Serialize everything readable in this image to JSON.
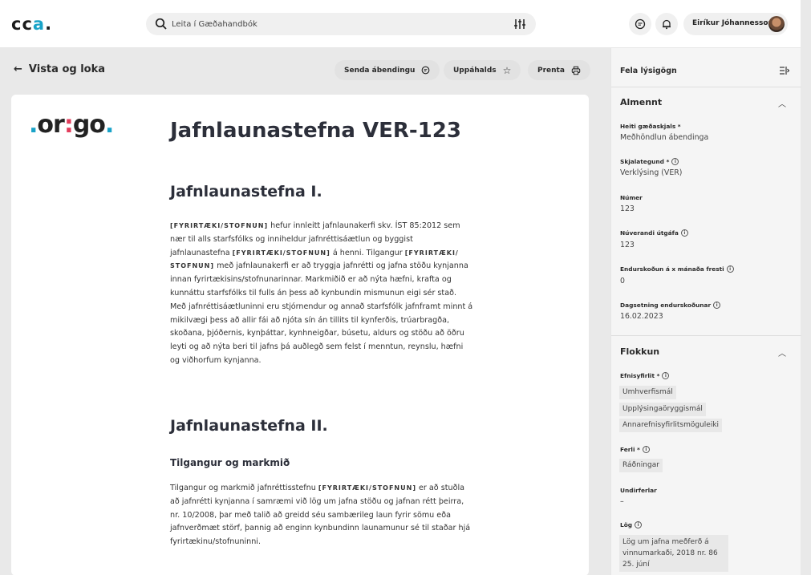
{
  "app": {
    "logo": "cca.",
    "search_placeholder": "Leita í Gæðahandbók",
    "user_name": "Eiríkur Jóhannesson"
  },
  "actions": {
    "back_label": "Vista og loka",
    "send_feedback": "Senda ábendingu",
    "favorites": "Uppáhalds",
    "print": "Prenta"
  },
  "document": {
    "company_logo": "origo.",
    "title": "Jafnlaunastefna VER-123",
    "section1_title": "Jafnlaunastefna I.",
    "section1_body": {
      "p1_tag": "[FYRIRTÆKI/STOFNUN]",
      "p1_text1": " hefur innleitt jafnlaunakerfi skv. ÍST 85:2012 sem nær til alls starfsfólks og inniheldur jafnréttisáætlun og byggist jafnlaunastefna ",
      "p1_tag2": "[FYRIRTÆKI/STOFNUN]",
      "p1_text2": " á henni. Tilgangur ",
      "p1_tag3": "[FYRIRTÆKI/ STOFNUN]",
      "p1_text3": " með jafnlaunakerfi er að tryggja jafnrétti og jafna stöðu kynjanna innan fyrirtækisins/stofnunarinnar. Markmiðið er að nýta hæfni, krafta og kunnáttu starfsfólks til fulls án þess að kynbundin mismunun eigi sér stað. Með jafnréttisáætluninni eru stjórnendur og annað starfsfólk jafnframt minnt á mikilvægi þess að allir fái að njóta sín án tillits til kynferðis, trúarbragða, skoðana, þjóðernis, kynþáttar, kynhneigðar, búsetu, aldurs og stöðu að öðru leyti og að nýta beri til jafns þá auðlegð sem felst í menntun, reynslu, hæfni og viðhorfum kynjanna."
    },
    "section2_title": "Jafnlaunastefna II.",
    "subsection_title": "Tilgangur og markmið",
    "section2_body": {
      "text1": "Tilgangur og markmið jafnréttisstefnu ",
      "tag": "[FYRIRTÆKI/STOFNUN]",
      "text2": " er að stuðla að jafnrétti kynjanna í samræmi við lög um jafna stöðu og jafnan rétt þeirra, nr. 10/2008, þar með talið að greidd séu sambærileg laun fyrir sömu eða jafnverðmæt störf, þannig að enginn kynbundinn launamunur sé til staðar hjá fyrirtækinu/stofnuninni."
    }
  },
  "panel": {
    "title": "Fela lýsigögn",
    "general": {
      "heading": "Almennt",
      "doc_name_label": "Heiti gæðaskjals *",
      "doc_name_value": "Meðhöndlun ábendinga",
      "doc_type_label": "Skjalategund *",
      "doc_type_value": "Verklýsing (VER)",
      "number_label": "Númer",
      "number_value": "123",
      "version_label": "Núverandi útgáfa",
      "version_value": "123",
      "review_label": "Endurskoðun á x mánaða fresti",
      "review_value": "0",
      "review_date_label": "Dagsetning endurskoðunar",
      "review_date_value": "16.02.2023"
    },
    "classification": {
      "heading": "Flokkun",
      "topics_label": "Efnisyfirlit *",
      "topics": [
        "Umhverfismál",
        "Upplýsingaöryggismál",
        "Annarefnisyfirlitsmöguleiki"
      ],
      "process_label": "Ferli *",
      "process_value": "Ráðningar",
      "subprocess_label": "Undirferlar",
      "subprocess_value": "–",
      "law_label": "Lög",
      "law_value": "Lög um jafna meðferð á vinnumarkaði, 2018 nr. 86 25. júní"
    }
  },
  "colors": {
    "accent": "#19a3c8",
    "logo_red": "#e33c5b"
  }
}
